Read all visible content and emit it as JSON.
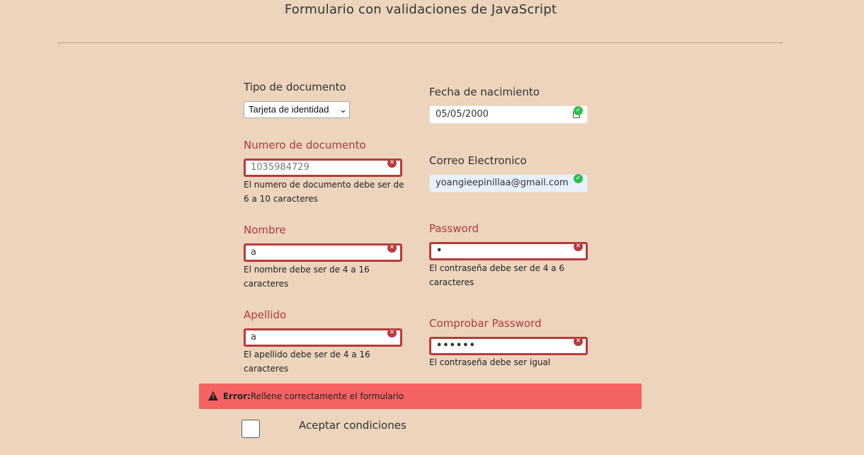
{
  "page": {
    "title": "Formulario con validaciones de JavaScript"
  },
  "form": {
    "tipo_documento": {
      "label": "Tipo de documento",
      "selected": "Tarjeta de identidad"
    },
    "fecha_nacimiento": {
      "label": "Fecha de nacimiento",
      "value": "05/05/2000",
      "status": "valid"
    },
    "numero_documento": {
      "label": "Numero de documento",
      "placeholder": "1035984729",
      "status": "invalid",
      "error": "El numero de documento debe ser de 6 a 10 caracteres"
    },
    "correo": {
      "label": "Correo Electronico",
      "value": "yoangieepinillaa@gmail.com",
      "status": "valid"
    },
    "nombre": {
      "label": "Nombre",
      "value": "a",
      "status": "invalid",
      "error": "El nombre debe ser de 4 a 16 caracteres"
    },
    "password": {
      "label": "Password",
      "value": "•",
      "status": "invalid",
      "error": "El contraseña debe ser de 4 a 6 caracteres"
    },
    "apellido": {
      "label": "Apellido",
      "value": "a",
      "status": "invalid",
      "error": "El apellido debe ser de 4 a 16 caracteres"
    },
    "comprobar_password": {
      "label": "Comprobar Password",
      "value": "••••••",
      "status": "invalid",
      "error": "El contraseña debe ser igual"
    },
    "alert": {
      "title": "Error:",
      "message": "Rellene correctamente el formulario"
    },
    "terminos": {
      "label": "Aceptar condiciones",
      "checked": false
    }
  },
  "colors": {
    "background": "#ecd4bd",
    "error": "#b93a3a",
    "success": "#2fbf4b",
    "alert": "#f46262"
  },
  "icons": {
    "valid": "check-circle-icon",
    "invalid": "x-circle-icon",
    "alert": "warning-triangle-icon",
    "date": "calendar-icon"
  }
}
